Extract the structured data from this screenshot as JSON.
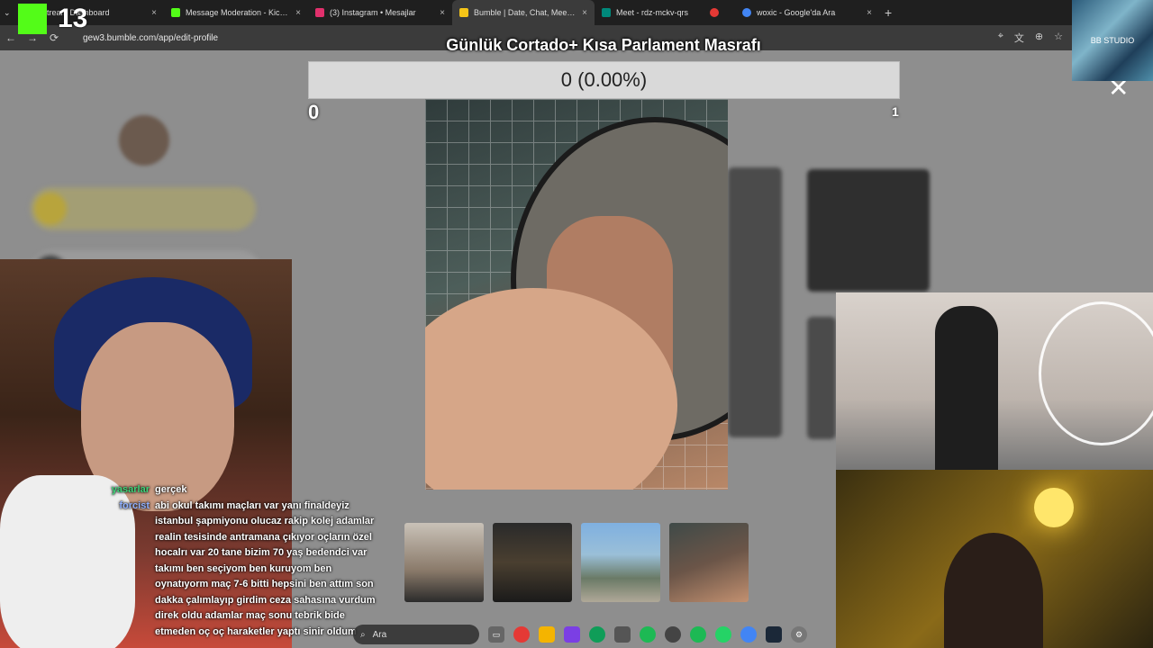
{
  "tabs": [
    {
      "title": "Stream Dashboard",
      "favicon_color": "#53fc18",
      "active": false
    },
    {
      "title": "Message Moderation - Kick Da",
      "favicon_color": "#53fc18",
      "active": false
    },
    {
      "title": "(3) Instagram • Mesajlar",
      "favicon_color": "#e1306c",
      "active": false
    },
    {
      "title": "Bumble | Date, Chat, Meet New",
      "favicon_color": "#f5c518",
      "active": true
    },
    {
      "title": "Meet - rdz-mckv-qrs",
      "favicon_color": "#00897b",
      "active": false
    },
    {
      "title": "",
      "favicon_color": "#e53935",
      "active": false
    },
    {
      "title": "woxic - Google'da Ara",
      "favicon_color": "#4285f4",
      "active": false
    }
  ],
  "tab_close": "×",
  "new_tab": "+",
  "address": {
    "url": "gew3.bumble.com/app/edit-profile"
  },
  "overlay": {
    "title": "Günlük Cortado+ Kısa Parlament Masrafı",
    "progress_text": "0 (0.00%)",
    "progress_fraction": 0,
    "min_label": "0",
    "max_label": "1",
    "close": "✕"
  },
  "logo": {
    "number": "13"
  },
  "brand_box": {
    "label": "BB STUDIO"
  },
  "chat": [
    {
      "user": "yasarlar",
      "user_color": "#3fd47a",
      "text": "gerçek"
    },
    {
      "user": "forcist",
      "user_color": "#8fb0ff",
      "text": "abi okul takımı maçları var yanı finaldeyiz istanbul şapmiyonu olucaz rakip kolej adamlar realin tesisinde antramana çıkıyor oçların özel hocalrı var 20 tane bizim 70 yaş bedendci var takımı ben seçiyom ben kuruyom ben oynatıyorm maç 7-6 bitti hepsini ben attım son dakka çalımlayıp girdim ceza sahasına vurdum direk oldu adamlar maç sonu tebrik bide etmeden oç oç haraketler yaptı sinir oldum"
    }
  ],
  "taskbar": {
    "search_placeholder": "Ara"
  },
  "colors": {
    "kick_green": "#53fc18",
    "page_dim": "#8e8e8e",
    "tab_bg": "#1f1f1f"
  }
}
